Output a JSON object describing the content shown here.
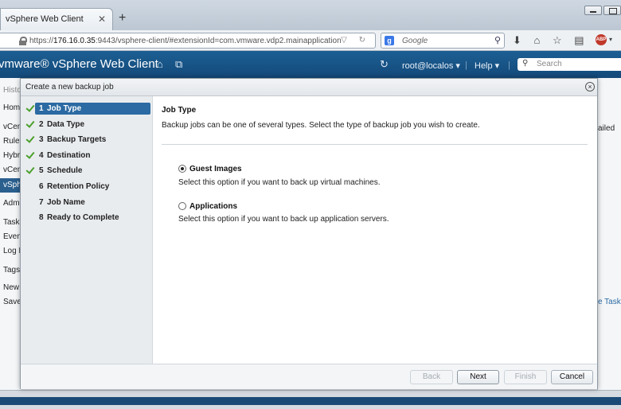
{
  "browser": {
    "tab_title": "vSphere Web Client",
    "tab_close": "✕",
    "new_tab": "+",
    "url_host": "176.16.0.35",
    "url_prefix": "https://",
    "url_rest": ":9443/vsphere-client/#extensionId=com.vmware.vdp2.mainapplication",
    "search_provider": "Google",
    "search_icon": "magnifier-icon"
  },
  "header": {
    "brand": "vmware® vSphere Web Client",
    "user": "root@localos ▾",
    "help": "Help ▾",
    "search_placeholder": "Search",
    "bg_color": "#1a5585"
  },
  "background": {
    "left_items": [
      "Histo",
      "Hom",
      "vCen",
      "Rule",
      "Hybri",
      "vCen",
      "vSph",
      "Adm",
      "Task",
      "Even",
      "Log B",
      "Tags",
      "New",
      "Save"
    ],
    "right_items": [
      "ailed",
      "e Tasks"
    ]
  },
  "dialog": {
    "title": "Create a new backup job",
    "close": "×",
    "steps": [
      {
        "num": "1",
        "label": "Job Type",
        "done": true,
        "active": true
      },
      {
        "num": "2",
        "label": "Data Type",
        "done": true,
        "active": false
      },
      {
        "num": "3",
        "label": "Backup Targets",
        "done": true,
        "active": false
      },
      {
        "num": "4",
        "label": "Destination",
        "done": true,
        "active": false
      },
      {
        "num": "5",
        "label": "Schedule",
        "done": true,
        "active": false
      },
      {
        "num": "6",
        "label": "Retention Policy",
        "done": false,
        "active": false
      },
      {
        "num": "7",
        "label": "Job Name",
        "done": false,
        "active": false
      },
      {
        "num": "8",
        "label": "Ready to Complete",
        "done": false,
        "active": false
      }
    ],
    "section_title": "Job Type",
    "section_desc": "Backup jobs can be one of several types. Select the type of backup job you wish to create.",
    "options": [
      {
        "label": "Guest Images",
        "desc": "Select this option if you want to back up virtual machines.",
        "checked": true
      },
      {
        "label": "Applications",
        "desc": "Select this option if you want to back up application servers.",
        "checked": false
      }
    ],
    "buttons": {
      "back": "Back",
      "next": "Next",
      "finish": "Finish",
      "cancel": "Cancel"
    }
  }
}
